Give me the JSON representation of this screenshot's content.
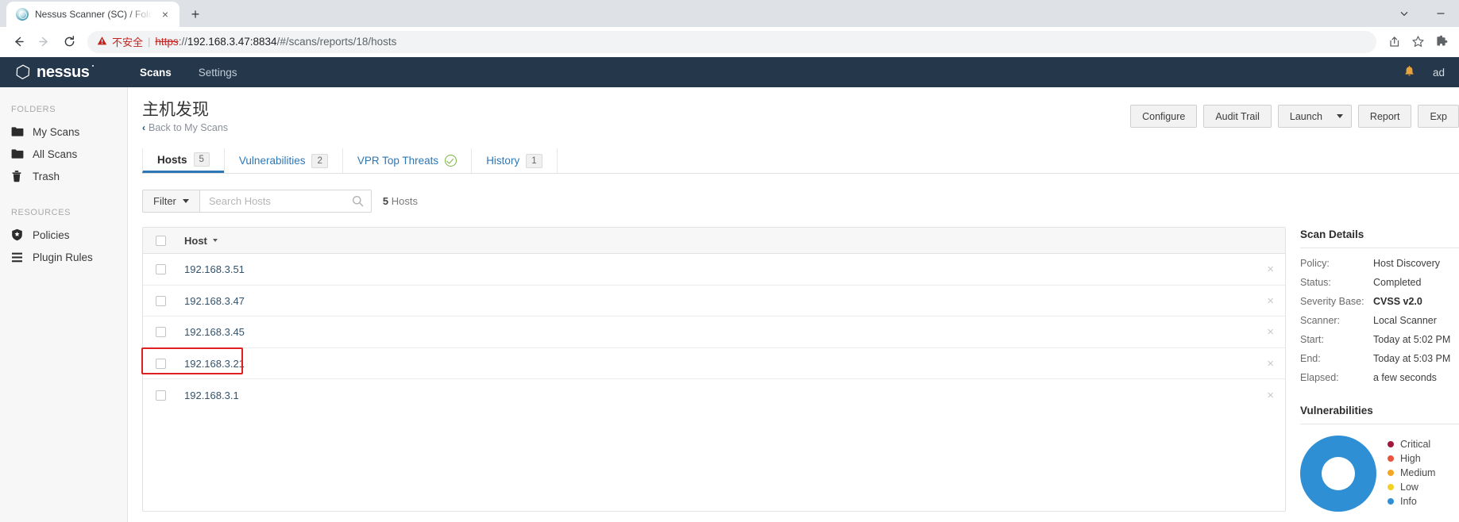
{
  "browser": {
    "tab": {
      "title": "Nessus Scanner (SC) / Folders",
      "favicon": "nessus-favicon",
      "close_label": "×"
    },
    "new_tab_label": "+",
    "window": {
      "minimize_label": "—",
      "dropdown_label": "⌄"
    },
    "nav": {
      "back": "←",
      "forward": "→",
      "reload": "↻"
    },
    "omnibox": {
      "warning_icon": "warning-triangle",
      "warning_text": "不安全",
      "separator": "|",
      "url_scheme": "https",
      "url_sep": "://",
      "url_host": "192.168.3.47:8834",
      "url_path": "/#/scans/reports/18/hosts"
    },
    "toolbar_icons": [
      "share-icon",
      "bookmark-star-icon",
      "extensions-puzzle-icon"
    ]
  },
  "header": {
    "logo_text": "nessus",
    "nav": [
      {
        "label": "Scans",
        "active": true
      },
      {
        "label": "Settings",
        "active": false
      }
    ],
    "notification_icon": "bell-icon",
    "user": "ad"
  },
  "sidebar": {
    "sections": [
      {
        "title": "FOLDERS",
        "items": [
          {
            "label": "My Scans",
            "icon": "folder-icon"
          },
          {
            "label": "All Scans",
            "icon": "folder-icon"
          },
          {
            "label": "Trash",
            "icon": "trash-icon"
          }
        ]
      },
      {
        "title": "RESOURCES",
        "items": [
          {
            "label": "Policies",
            "icon": "shield-icon"
          },
          {
            "label": "Plugin Rules",
            "icon": "list-icon"
          }
        ]
      }
    ]
  },
  "page": {
    "title": "主机发现",
    "back_link": "Back to My Scans",
    "back_chevron": "‹"
  },
  "actions": [
    {
      "label": "Configure",
      "name": "configure-button"
    },
    {
      "label": "Audit Trail",
      "name": "audit-trail-button"
    },
    {
      "label": "Launch",
      "name": "launch-button",
      "has_caret": true
    },
    {
      "label": "Report",
      "name": "report-button"
    },
    {
      "label": "Exp",
      "name": "export-button"
    }
  ],
  "tabs": [
    {
      "label": "Hosts",
      "badge": "5",
      "active": true,
      "name": "tab-hosts"
    },
    {
      "label": "Vulnerabilities",
      "badge": "2",
      "active": false,
      "name": "tab-vulnerabilities"
    },
    {
      "label": "VPR Top Threats",
      "check": true,
      "active": false,
      "name": "tab-vpr-top-threats"
    },
    {
      "label": "History",
      "badge": "1",
      "active": false,
      "name": "tab-history"
    }
  ],
  "filter": {
    "filter_label": "Filter",
    "search_placeholder": "Search Hosts",
    "search_value": "",
    "count_number": "5",
    "count_label": "Hosts"
  },
  "table": {
    "columns": [
      {
        "label": "Host",
        "sorted": true
      }
    ],
    "rows": [
      {
        "host": "192.168.3.51",
        "highlighted": false
      },
      {
        "host": "192.168.3.47",
        "highlighted": false
      },
      {
        "host": "192.168.3.45",
        "highlighted": false
      },
      {
        "host": "192.168.3.21",
        "highlighted": true
      },
      {
        "host": "192.168.3.1",
        "highlighted": false
      }
    ],
    "remove_label": "×"
  },
  "scan_details": {
    "title": "Scan Details",
    "rows": [
      {
        "label": "Policy:",
        "value": "Host Discovery",
        "bold": false
      },
      {
        "label": "Status:",
        "value": "Completed",
        "bold": false
      },
      {
        "label": "Severity Base:",
        "value": "CVSS v2.0",
        "bold": true
      },
      {
        "label": "Scanner:",
        "value": "Local Scanner",
        "bold": false
      },
      {
        "label": "Start:",
        "value": "Today at 5:02 PM",
        "bold": false
      },
      {
        "label": "End:",
        "value": "Today at 5:03 PM",
        "bold": false
      },
      {
        "label": "Elapsed:",
        "value": "a few seconds",
        "bold": false
      }
    ]
  },
  "vulnerabilities": {
    "title": "Vulnerabilities",
    "legend": [
      {
        "label": "Critical",
        "color": "#a0193c"
      },
      {
        "label": "High",
        "color": "#e8543f"
      },
      {
        "label": "Medium",
        "color": "#f5a623"
      },
      {
        "label": "Low",
        "color": "#f2d024"
      },
      {
        "label": "Info",
        "color": "#2e8fd4"
      }
    ],
    "donut_color": "#2e8fd4"
  },
  "annotation": {
    "color": "#e02020",
    "target": "192.168.3.21"
  }
}
